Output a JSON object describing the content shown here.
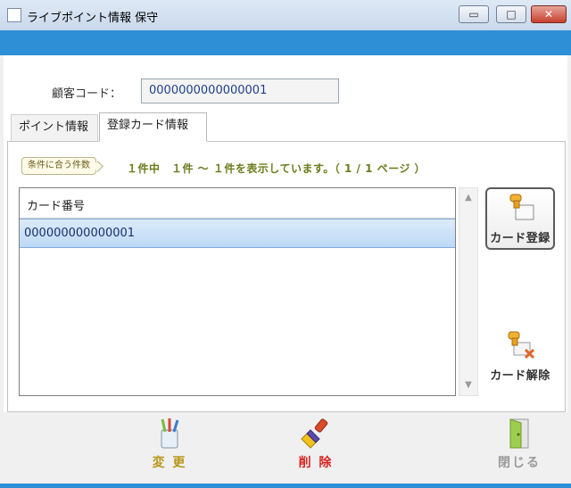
{
  "window": {
    "title": "ライブポイント情報 保守",
    "min_symbol": "▭",
    "max_symbol": "□",
    "close_symbol": "✕"
  },
  "customer": {
    "label": "顧客コード：",
    "value": "0000000000000001"
  },
  "tabs": [
    {
      "label": "ポイント情報",
      "active": false
    },
    {
      "label": "登録カード情報",
      "active": true
    }
  ],
  "filter": {
    "badge": "条件に合う件数",
    "paging": "１件中　１件 ～ １件を表示しています。（ 1 / 1 ページ ）"
  },
  "list": {
    "header": "カード番号",
    "rows": [
      "000000000000001"
    ]
  },
  "side_buttons": {
    "register": "カード登録",
    "release": "カード解除"
  },
  "bottom_buttons": {
    "change": "変 更",
    "delete": "削 除",
    "close": "閉じる"
  },
  "colors": {
    "accent_blue": "#2f8fd6",
    "change_label": "#b8961a",
    "delete_label": "#d8231f",
    "close_label": "#9a9a9a"
  }
}
